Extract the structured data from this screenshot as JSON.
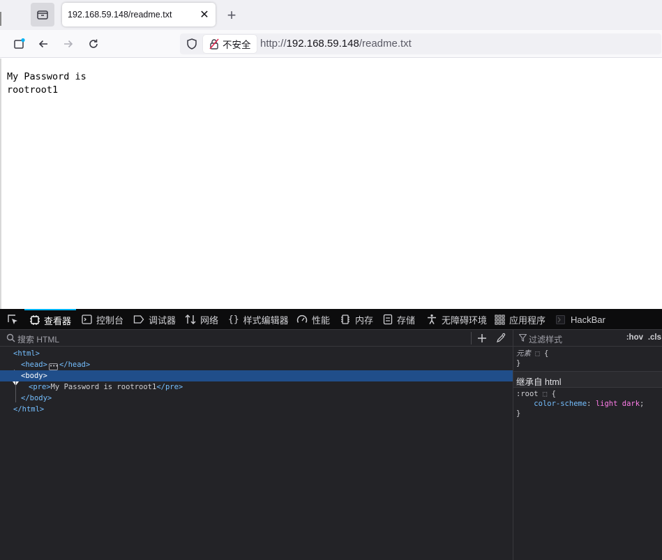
{
  "browser": {
    "tab_title": "192.168.59.148/readme.txt",
    "insecure_label": "不安全",
    "url_scheme": "http://",
    "url_host": "192.168.59.148",
    "url_path": "/readme.txt"
  },
  "page": {
    "line1": "My Password is",
    "line2": "rootroot1"
  },
  "devtools": {
    "tabs": [
      {
        "label": "查看器",
        "icon": "inspector-icon",
        "active": true
      },
      {
        "label": "控制台",
        "icon": "console-icon"
      },
      {
        "label": "调试器",
        "icon": "debugger-icon"
      },
      {
        "label": "网络",
        "icon": "network-icon"
      },
      {
        "label": "样式编辑器",
        "icon": "style-editor-icon"
      },
      {
        "label": "性能",
        "icon": "performance-icon"
      },
      {
        "label": "内存",
        "icon": "memory-icon"
      },
      {
        "label": "存储",
        "icon": "storage-icon"
      },
      {
        "label": "无障碍环境",
        "icon": "accessibility-icon"
      },
      {
        "label": "应用程序",
        "icon": "application-icon"
      },
      {
        "label": "HackBar",
        "icon": "hackbar-icon"
      }
    ],
    "search_placeholder": "搜索 HTML",
    "tree": {
      "html_open": "<html>",
      "head_open": "<head>",
      "head_close": "</head>",
      "body_open": "<body>",
      "pre_open": "<pre>",
      "pre_text": "My Password is rootroot1",
      "pre_close": "</pre>",
      "body_close": "</body>",
      "html_close": "</html>"
    },
    "rules": {
      "filter_placeholder": "过滤样式",
      "hov": ":hov",
      "cls": ".cls",
      "element_label": "元素",
      "open_brace": "{",
      "close_brace": "}",
      "inherited_label": "继承自 html",
      "root_selector": ":root",
      "prop_name": "color-scheme",
      "prop_value": "light dark"
    }
  },
  "colors": {
    "accent": "#00b3f4",
    "selection": "#204e8a",
    "tag": "#75bfff",
    "value": "#ff7de9"
  }
}
